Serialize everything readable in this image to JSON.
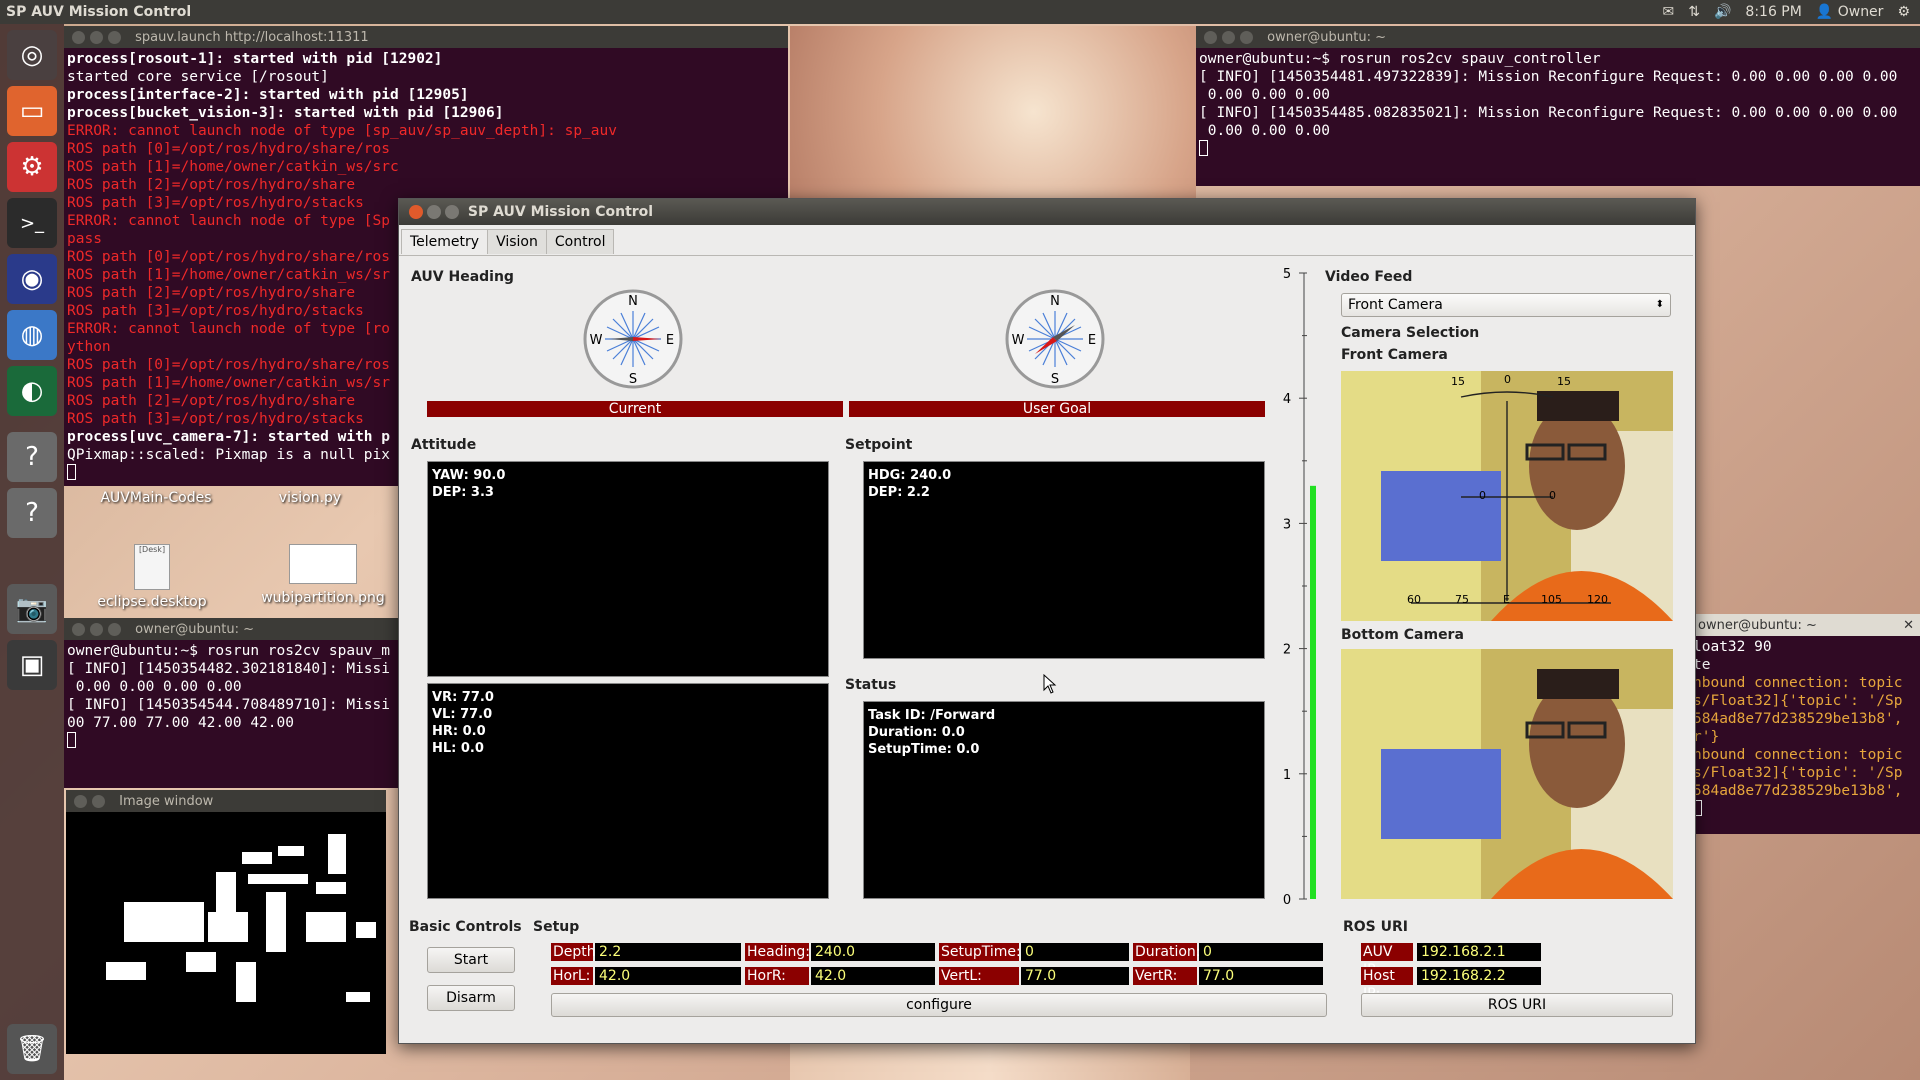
{
  "top_panel": {
    "title": "SP AUV Mission Control",
    "time": "8:16 PM",
    "user": "Owner"
  },
  "terminals": {
    "launch": {
      "title": "spauv.launch http://localhost:11311",
      "lines": [
        {
          "t": "process[rosout-1]: started with pid [12902]",
          "c": "bold"
        },
        {
          "t": "started core service [/rosout]",
          "c": ""
        },
        {
          "t": "process[interface-2]: started with pid [12905]",
          "c": "bold"
        },
        {
          "t": "process[bucket_vision-3]: started with pid [12906]",
          "c": "bold"
        },
        {
          "t": "ERROR: cannot launch node of type [sp_auv/sp_auv_depth]: sp_auv",
          "c": "err"
        },
        {
          "t": "ROS path [0]=/opt/ros/hydro/share/ros",
          "c": "err"
        },
        {
          "t": "ROS path [1]=/home/owner/catkin_ws/src",
          "c": "err"
        },
        {
          "t": "ROS path [2]=/opt/ros/hydro/share",
          "c": "err"
        },
        {
          "t": "ROS path [3]=/opt/ros/hydro/stacks",
          "c": "err"
        },
        {
          "t": "ERROR: cannot launch node of type [Sp",
          "c": "err"
        },
        {
          "t": "pass",
          "c": "err"
        },
        {
          "t": "ROS path [0]=/opt/ros/hydro/share/ros",
          "c": "err"
        },
        {
          "t": "ROS path [1]=/home/owner/catkin_ws/sr",
          "c": "err"
        },
        {
          "t": "ROS path [2]=/opt/ros/hydro/share",
          "c": "err"
        },
        {
          "t": "ROS path [3]=/opt/ros/hydro/stacks",
          "c": "err"
        },
        {
          "t": "ERROR: cannot launch node of type [ro",
          "c": "err"
        },
        {
          "t": "ython",
          "c": "err"
        },
        {
          "t": "ROS path [0]=/opt/ros/hydro/share/ros",
          "c": "err"
        },
        {
          "t": "ROS path [1]=/home/owner/catkin_ws/sr",
          "c": "err"
        },
        {
          "t": "ROS path [2]=/opt/ros/hydro/share",
          "c": "err"
        },
        {
          "t": "ROS path [3]=/opt/ros/hydro/stacks",
          "c": "err"
        },
        {
          "t": "process[uvc_camera-7]: started with p",
          "c": "bold"
        },
        {
          "t": "QPixmap::scaled: Pixmap is a null pix",
          "c": ""
        }
      ]
    },
    "controller": {
      "title": "owner@ubuntu: ~",
      "lines": [
        {
          "t": "owner@ubuntu:~$ rosrun ros2cv spauv_controller",
          "c": ""
        },
        {
          "t": "[ INFO] [1450354481.497322839]: Mission Reconfigure Request: 0.00 0.00 0.00 0.00",
          "c": ""
        },
        {
          "t": " 0.00 0.00 0.00",
          "c": ""
        },
        {
          "t": "[ INFO] [1450354485.082835021]: Mission Reconfigure Request: 0.00 0.00 0.00 0.00",
          "c": ""
        },
        {
          "t": " 0.00 0.00 0.00",
          "c": ""
        }
      ]
    },
    "small": {
      "title": "owner@ubuntu: ~",
      "lines": [
        {
          "t": "owner@ubuntu:~$ rosrun ros2cv spauv_m",
          "c": ""
        },
        {
          "t": "[ INFO] [1450354482.302181840]: Missi",
          "c": ""
        },
        {
          "t": " 0.00 0.00 0.00 0.00",
          "c": ""
        },
        {
          "t": "[ INFO] [1450354544.708489710]: Missi",
          "c": ""
        },
        {
          "t": "00 77.00 77.00 42.00 42.00",
          "c": ""
        }
      ]
    },
    "right": {
      "title": "owner@ubuntu: ~",
      "lines": [
        {
          "t": "loat32 90",
          "c": ""
        },
        {
          "t": "te",
          "c": ""
        },
        {
          "t": "nbound connection: topic",
          "c": "warn"
        },
        {
          "t": "s/Float32]{'topic': '/Sp",
          "c": "warn"
        },
        {
          "t": "584ad8e77d238529be13b8',",
          "c": "warn"
        },
        {
          "t": "r'}",
          "c": "warn"
        },
        {
          "t": "nbound connection: topic",
          "c": "warn"
        },
        {
          "t": "s/Float32]{'topic': '/Sp",
          "c": "warn"
        },
        {
          "t": "584ad8e77d238529be13b8',",
          "c": "warn"
        }
      ]
    }
  },
  "desktop_icons": [
    "AUVMain-Codes",
    "vision.py",
    "eclipse.desktop",
    "wubipartition.png"
  ],
  "image_window": {
    "title": "Image window"
  },
  "app": {
    "title": "SP AUV Mission Control",
    "tabs": [
      "Telemetry",
      "Vision",
      "Control"
    ],
    "heading_label": "AUV Heading",
    "compass_letters": {
      "n": "N",
      "s": "S",
      "e": "E",
      "w": "W"
    },
    "compass_current_label": "Current",
    "compass_goal_label": "User Goal",
    "attitude_label": "Attitude",
    "setpoint_label": "Setpoint",
    "status_label": "Status",
    "attitude": {
      "yaw": "YAW: 90.0",
      "dep": "DEP: 3.3"
    },
    "thrusters": {
      "vr": "VR: 77.0",
      "vl": "VL: 77.0",
      "hr": "HR: 0.0",
      "hl": "HL: 0.0"
    },
    "setpoint": {
      "hdg": "HDG: 240.0",
      "dep": "DEP: 2.2"
    },
    "status": {
      "task": "Task ID: /Forward",
      "duration": "Duration: 0.0",
      "setup": "SetupTime: 0.0"
    },
    "depth_scale": {
      "ticks": [
        "5",
        "4",
        "3",
        "2",
        "1",
        "0"
      ],
      "level": 3.3
    },
    "video": {
      "label": "Video Feed",
      "selected": "Front Camera",
      "camera_selection_label": "Camera Selection",
      "front_label": "Front Camera",
      "bottom_label": "Bottom Camera",
      "hud_top": [
        "15",
        "0",
        "15"
      ],
      "hud_mid": [
        "0",
        "0"
      ],
      "hud_bottom": [
        "60",
        "75",
        "E",
        "105",
        "120"
      ]
    },
    "basic_controls": {
      "label": "Basic Controls",
      "start": "Start",
      "disarm": "Disarm"
    },
    "setup": {
      "label": "Setup",
      "row1": [
        {
          "k": "Depth:",
          "v": "2.2"
        },
        {
          "k": "Heading:",
          "v": "240.0"
        },
        {
          "k": "SetupTime:",
          "v": "0"
        },
        {
          "k": "Duration:",
          "v": "0"
        }
      ],
      "row2": [
        {
          "k": "HorL:",
          "v": "42.0"
        },
        {
          "k": "HorR:",
          "v": "42.0"
        },
        {
          "k": "VertL:",
          "v": "77.0"
        },
        {
          "k": "VertR:",
          "v": "77.0"
        }
      ],
      "configure": "configure"
    },
    "ros_uri": {
      "label": "ROS URI",
      "auv_ip_label": "AUV IP:",
      "auv_ip": "192.168.2.1",
      "host_ip_label": "Host IP:",
      "host_ip": "192.168.2.2",
      "button": "ROS URI"
    }
  },
  "colors": {
    "accent_red": "#8b0000",
    "depth_bar": "#22e022",
    "terminal_bg": "#300a24"
  }
}
